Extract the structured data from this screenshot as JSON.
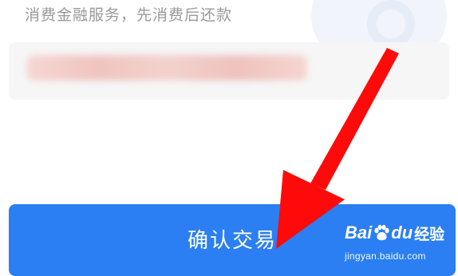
{
  "subtitle": "消费金融服务，先消费后还款",
  "confirm_button": {
    "label": "确认交易"
  },
  "watermark": {
    "bai": "Bai",
    "du": "du",
    "jingyan": "经验",
    "url": "jingyan.baidu.com"
  },
  "colors": {
    "primary_button": "#2b7ff2",
    "arrow": "#ff0a0a",
    "card_background": "#f6f6f6"
  }
}
